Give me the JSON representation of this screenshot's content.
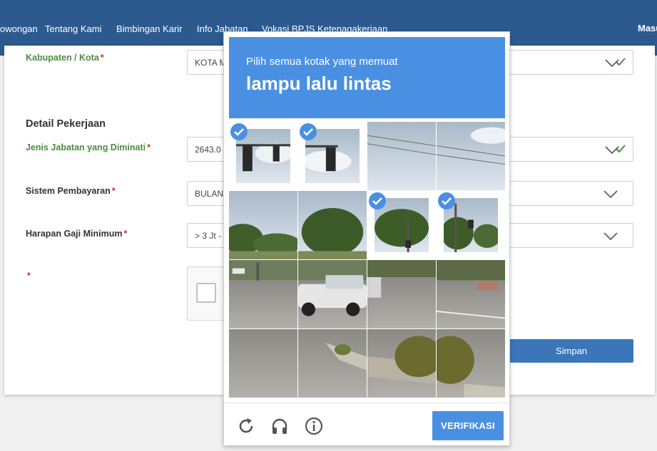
{
  "nav": {
    "items": [
      "owongan",
      "Tentang Kami",
      "Bimbingan Karir",
      "Info Jabatan",
      "Vokasi BPJS Ketenagakerjaan"
    ],
    "right": "Masu"
  },
  "form": {
    "kabupaten": {
      "label": "Kabupaten / Kota",
      "value": "KOTA M"
    },
    "section_title": "Detail Pekerjaan",
    "jabatan": {
      "label": "Jenis Jabatan yang Diminati",
      "value": "2643.0"
    },
    "pembayaran": {
      "label": "Sistem Pembayaran",
      "value": "BULAN"
    },
    "gaji": {
      "label": "Harapan Gaji Minimum",
      "value": "> 3 Jt -"
    },
    "required_mark": "*",
    "submit_label": "Simpan"
  },
  "captcha": {
    "instruction": "Pilih semua kotak yang memuat",
    "object": "lampu lalu lintas",
    "tiles_selected": [
      true,
      true,
      false,
      false,
      false,
      false,
      true,
      true,
      false,
      false,
      false,
      false,
      false,
      false,
      false,
      false
    ],
    "verify_label": "VERIFIKASI",
    "icons": [
      "reload-icon",
      "audio-icon",
      "info-icon"
    ]
  },
  "colors": {
    "nav_bg": "#2c5a8f",
    "captcha_blue": "#4a90e2",
    "label_green": "#4a8c3f",
    "required_red": "#c0392b",
    "submit_bg": "#3b76b8"
  }
}
